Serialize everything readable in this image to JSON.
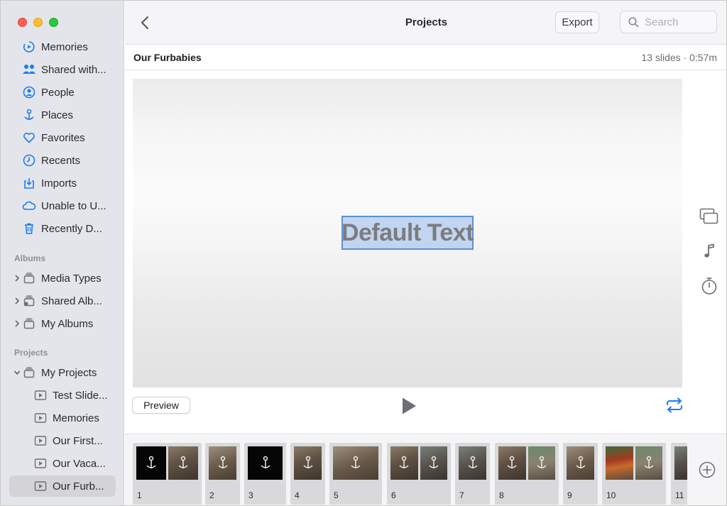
{
  "window": {
    "traffic_lights": [
      "close",
      "minimize",
      "zoom"
    ]
  },
  "sidebar": {
    "items": [
      {
        "label": "Memories",
        "icon": "memories-icon"
      },
      {
        "label": "Shared with...",
        "icon": "shared-with-you-icon"
      },
      {
        "label": "People",
        "icon": "people-icon"
      },
      {
        "label": "Places",
        "icon": "places-icon"
      },
      {
        "label": "Favorites",
        "icon": "heart-icon"
      },
      {
        "label": "Recents",
        "icon": "clock-icon"
      },
      {
        "label": "Imports",
        "icon": "import-icon"
      },
      {
        "label": "Unable to U...",
        "icon": "cloud-icon"
      },
      {
        "label": "Recently D...",
        "icon": "trash-icon"
      }
    ],
    "albums_header": "Albums",
    "albums": [
      {
        "label": "Media Types",
        "icon": "folder-stack-icon"
      },
      {
        "label": "Shared Alb...",
        "icon": "shared-folder-icon"
      },
      {
        "label": "My Albums",
        "icon": "folder-stack-icon"
      }
    ],
    "projects_header": "Projects",
    "projects_root": {
      "label": "My Projects",
      "icon": "folder-stack-icon"
    },
    "projects": [
      {
        "label": "Test Slide...",
        "icon": "slideshow-icon"
      },
      {
        "label": "Memories",
        "icon": "slideshow-icon"
      },
      {
        "label": "Our First...",
        "icon": "slideshow-icon"
      },
      {
        "label": "Our Vaca...",
        "icon": "slideshow-icon"
      },
      {
        "label": "Our Furb...",
        "icon": "slideshow-icon",
        "selected": true
      }
    ]
  },
  "toolbar": {
    "title": "Projects",
    "export_label": "Export",
    "search_placeholder": "Search"
  },
  "project": {
    "name": "Our Furbabies",
    "meta": "13 slides · 0:57m"
  },
  "slide_preview": {
    "text": "Default Text"
  },
  "controls": {
    "preview_label": "Preview",
    "side": [
      "themes-icon",
      "music-note-icon",
      "duration-icon"
    ]
  },
  "filmstrip": {
    "slides": [
      {
        "num": "1",
        "thumbs": [
          "dark",
          "photo"
        ]
      },
      {
        "num": "2",
        "thumbs": [
          "photo2"
        ]
      },
      {
        "num": "3",
        "thumbs": [
          "dark"
        ]
      },
      {
        "num": "4",
        "thumbs": [
          "photo"
        ]
      },
      {
        "num": "5",
        "thumbs": [
          "photo2"
        ]
      },
      {
        "num": "6",
        "thumbs": [
          "photo",
          "photo3"
        ]
      },
      {
        "num": "7",
        "thumbs": [
          "photo3"
        ]
      },
      {
        "num": "8",
        "thumbs": [
          "photo",
          "photo5"
        ]
      },
      {
        "num": "9",
        "thumbs": [
          "photo2"
        ]
      },
      {
        "num": "10",
        "thumbs": [
          "photo4",
          "photo5"
        ]
      },
      {
        "num": "11",
        "thumbs": [
          "photo3"
        ]
      }
    ]
  },
  "colors": {
    "accent": "#1b7cf0",
    "sidebar_bg": "#e4e5ea",
    "selection_fill": "#96b9eb"
  }
}
